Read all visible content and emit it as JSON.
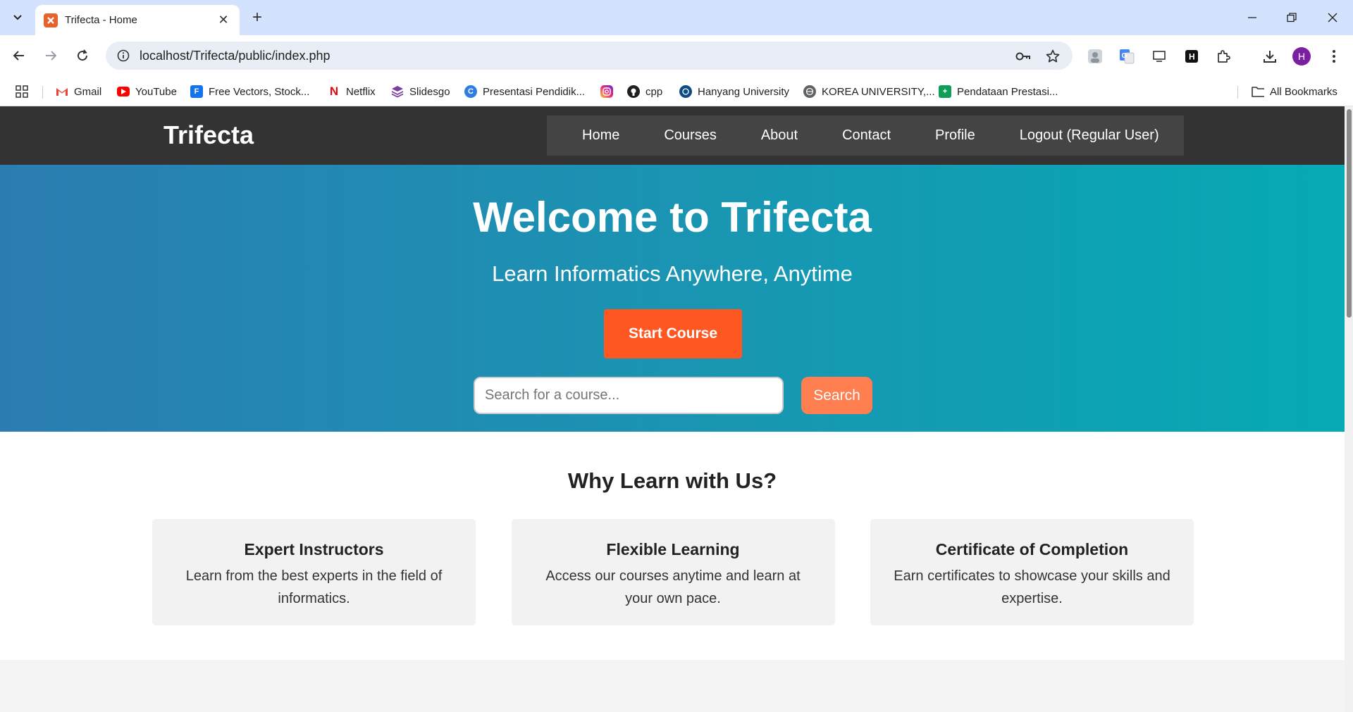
{
  "browser": {
    "tab_title": "Trifecta - Home",
    "url": "localhost/Trifecta/public/index.php",
    "profile_initial": "H",
    "bookmarks": [
      {
        "label": "Gmail",
        "icon": "gmail-icon",
        "color": "#ea4335"
      },
      {
        "label": "YouTube",
        "icon": "youtube-icon",
        "color": "#ff0000"
      },
      {
        "label": "Free Vectors, Stock...",
        "icon": "freepik-icon",
        "color": "#1273eb"
      },
      {
        "label": "Netflix",
        "icon": "netflix-icon",
        "color": "#e50914"
      },
      {
        "label": "Slidesgo",
        "icon": "slidesgo-icon",
        "color": "#7b3fa0"
      },
      {
        "label": "Presentasi Pendidik...",
        "icon": "canva-icon",
        "color": "#2f7de1"
      },
      {
        "label": "",
        "icon": "instagram-icon",
        "color": "#d62976"
      },
      {
        "label": "cpp",
        "icon": "github-icon",
        "color": "#1f1f1f"
      },
      {
        "label": "Hanyang University",
        "icon": "hanyang-icon",
        "color": "#0e4a84"
      },
      {
        "label": "KOREA UNIVERSITY,...",
        "icon": "globe-icon",
        "color": "#5f6368"
      },
      {
        "label": "Pendataan Prestasi...",
        "icon": "sheets-icon",
        "color": "#0f9d58"
      }
    ],
    "all_bookmarks": "All Bookmarks"
  },
  "site": {
    "logo": "Trifecta",
    "nav": [
      "Home",
      "Courses",
      "About",
      "Contact",
      "Profile",
      "Logout (Regular User)"
    ]
  },
  "hero": {
    "title": "Welcome to Trifecta",
    "subtitle": "Learn Informatics Anywhere, Anytime",
    "start_button": "Start Course",
    "search_placeholder": "Search for a course...",
    "search_button": "Search"
  },
  "features": {
    "title": "Why Learn with Us?",
    "cards": [
      {
        "title": "Expert Instructors",
        "description": "Learn from the best experts in the field of informatics."
      },
      {
        "title": "Flexible Learning",
        "description": "Access our courses anytime and learn at your own pace."
      },
      {
        "title": "Certificate of Completion",
        "description": "Earn certificates to showcase your skills and expertise."
      }
    ]
  },
  "colors": {
    "header_bg": "#333333",
    "nav_bg": "#444444",
    "accent_orange": "#ff5722",
    "search_orange": "#ff7f50",
    "hero_gradient_start": "#2b7db1",
    "hero_gradient_end": "#06aab5"
  }
}
